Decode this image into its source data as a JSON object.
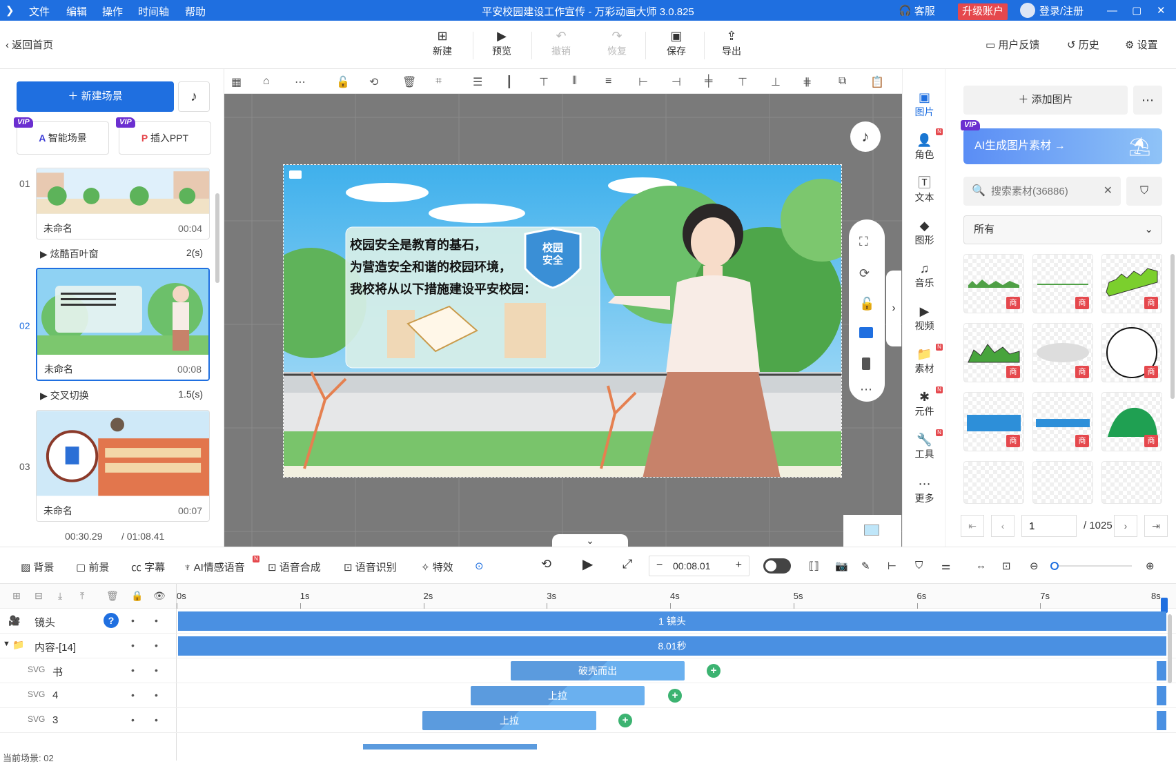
{
  "titlebar": {
    "menu": [
      "文件",
      "编辑",
      "操作",
      "时间轴",
      "帮助"
    ],
    "title": "平安校园建设工作宣传 - 万彩动画大师 3.0.825",
    "service": "客服",
    "upgrade": "升级账户",
    "login": "登录/注册"
  },
  "toolbar": {
    "back": "返回首页",
    "new": "新建",
    "preview": "预览",
    "undo": "撤销",
    "redo": "恢复",
    "save": "保存",
    "export": "导出",
    "feedback": "用户反馈",
    "history": "历史",
    "settings": "设置"
  },
  "left": {
    "new_scene": "新建场景",
    "smart_scene": "智能场景",
    "insert_ppt": "插入PPT",
    "vip": "VIP",
    "scenes": [
      {
        "num": "01",
        "name": "未命名",
        "time": "00:04"
      },
      {
        "num": "02",
        "name": "未命名",
        "time": "00:08"
      },
      {
        "num": "03",
        "name": "未命名",
        "time": "00:07"
      }
    ],
    "transitions": [
      {
        "name": "炫酷百叶窗",
        "dur": "2(s)"
      },
      {
        "name": "交叉切换",
        "dur": "1.5(s)"
      }
    ],
    "current_time": "00:30.29",
    "total_time": "/ 01:08.41"
  },
  "canvas": {
    "text_lines": [
      "校园安全是教育的基石，",
      "为营造安全和谐的校园环境，",
      "我校将从以下措施建设平安校园："
    ],
    "shield_text": "校园\n安全"
  },
  "rtabs": [
    "图片",
    "角色",
    "文本",
    "图形",
    "音乐",
    "视频",
    "素材",
    "元件",
    "工具",
    "更多"
  ],
  "rpanel": {
    "add_image": "添加图片",
    "ai_banner": "AI生成图片素材",
    "search_placeholder": "搜索素材(36886)",
    "filter_all": "所有",
    "badge": "商",
    "page": "1",
    "total_pages": "/ 1025"
  },
  "btools": {
    "items": [
      "背景",
      "前景",
      "字幕",
      "AI情感语音",
      "语音合成",
      "语音识别",
      "特效"
    ],
    "time": "00:08.01"
  },
  "timeline": {
    "ticks": [
      "0s",
      "1s",
      "2s",
      "3s",
      "4s",
      "5s",
      "6s",
      "7s",
      "8s"
    ],
    "rows": [
      {
        "name": "镜头",
        "bar": "1 镜头"
      },
      {
        "name": "内容-[14]",
        "bar": "8.01秒"
      },
      {
        "name": "书",
        "clip": "破壳而出"
      },
      {
        "name": "4",
        "clip": "上拉"
      },
      {
        "name": "3",
        "clip": "上拉"
      }
    ],
    "status": "当前场景: 02"
  },
  "colors": {
    "accent": "#1f6fe0",
    "vip": "#6b2fd0",
    "danger": "#e5484d"
  }
}
